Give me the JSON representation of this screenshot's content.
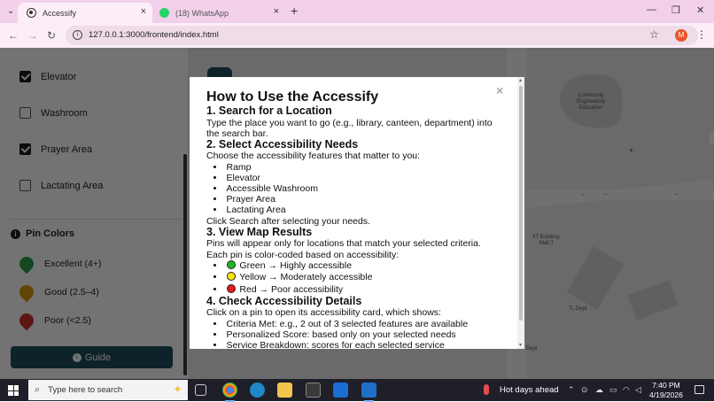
{
  "browser": {
    "tabs": [
      {
        "title": "Accessify",
        "active": true
      },
      {
        "title": "(18) WhatsApp",
        "active": false
      }
    ],
    "url": "127.0.0.1:3000/frontend/index.html",
    "profile_initial": "M",
    "new_tab_label": "+",
    "close_glyph": "×",
    "dropdown_glyph": "⌄"
  },
  "sidebar": {
    "filters": [
      {
        "label": "Elevator",
        "checked": true
      },
      {
        "label": "Washroom",
        "checked": false
      },
      {
        "label": "Prayer Area",
        "checked": true
      },
      {
        "label": "Lactating Area",
        "checked": false
      }
    ],
    "pin_colors_title": "Pin Colors",
    "legend": [
      {
        "label": "Excellent (4+)",
        "color": "#2e9e4a"
      },
      {
        "label": "Good (2.5–4)",
        "color": "#d99a0c"
      },
      {
        "label": "Poor (<2.5)",
        "color": "#d0312d"
      }
    ],
    "guide_label": "Guide"
  },
  "map": {
    "labels": [
      "Continuing Engineering Education",
      "IIT Building, Mall T",
      "TL Dept",
      "Dept"
    ]
  },
  "modal": {
    "close_glyph": "×",
    "title": "How to Use the Accessify",
    "s1_heading": "1. Search for a Location",
    "s1_text": "Type the place you want to go (e.g., library, canteen, department) into the search bar.",
    "s2_heading": "2. Select Accessibility Needs",
    "s2_text": "Choose the accessibility features that matter to you:",
    "s2_items": [
      "Ramp",
      "Elevator",
      "Accessible Washroom",
      "Prayer Area",
      "Lactating Area"
    ],
    "s2_after": "Click Search after selecting your needs.",
    "s3_heading": "3. View Map Results",
    "s3_text1": "Pins will appear only for locations that match your selected criteria.",
    "s3_text2": "Each pin is color-coded based on accessibility:",
    "s3_colors": [
      {
        "text": "Green → Highly accessible",
        "color": "#1fb81f"
      },
      {
        "text": "Yellow → Moderately accessible",
        "color": "#f5e50a"
      },
      {
        "text": "Red → Poor accessibility",
        "color": "#e81919"
      }
    ],
    "s4_heading": "4. Check Accessibility Details",
    "s4_text": "Click on a pin to open its accessibility card, which shows:",
    "s4_items": [
      "Criteria Met: e.g., 2 out of 3 selected features are available",
      "Personalized Score: based only on your selected needs",
      "Service Breakdown: scores for each selected service"
    ]
  },
  "taskbar": {
    "search_placeholder": "Type here to search",
    "weather": "Hot days ahead",
    "time": "7:40 PM",
    "date": "4/19/2026"
  }
}
